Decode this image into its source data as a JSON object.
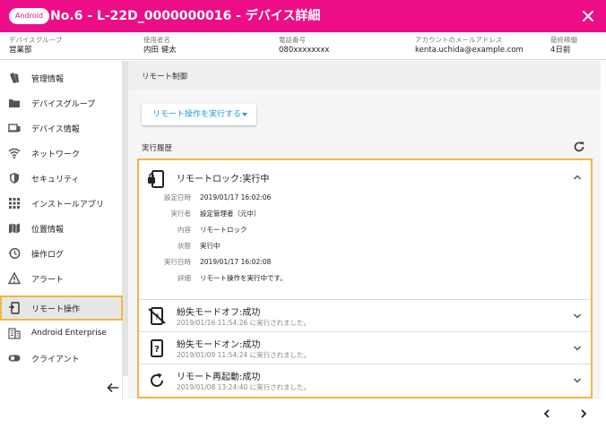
{
  "header": {
    "os_badge": "Android",
    "title": "No.6 - L-22D_0000000016 - デバイス詳細",
    "bg_color": "#ed0d87"
  },
  "info": {
    "group_label": "デバイスグループ",
    "group_value": "営業部",
    "user_label": "使用者名",
    "user_value": "内田 健太",
    "phone_label": "電話番号",
    "phone_value": "080xxxxxxxx",
    "email_label": "アカウントのメールアドレス",
    "email_value": "kenta.uchida@example.com",
    "last_label": "最終稼働",
    "last_value": "4日前"
  },
  "sidebar": {
    "items": [
      {
        "label": "管理情報",
        "icon": "book-icon"
      },
      {
        "label": "デバイスグループ",
        "icon": "folder-icon"
      },
      {
        "label": "デバイス情報",
        "icon": "devices-icon"
      },
      {
        "label": "ネットワーク",
        "icon": "wifi-icon"
      },
      {
        "label": "セキュリティ",
        "icon": "shield-icon"
      },
      {
        "label": "インストールアプリ",
        "icon": "apps-grid-icon"
      },
      {
        "label": "位置情報",
        "icon": "map-icon"
      },
      {
        "label": "操作ログ",
        "icon": "history-icon"
      },
      {
        "label": "アラート",
        "icon": "warning-icon"
      },
      {
        "label": "リモート操作",
        "icon": "phone-remote-icon",
        "active": true
      },
      {
        "label": "Android Enterprise",
        "icon": "business-icon"
      },
      {
        "label": "クライアント",
        "icon": "toggle-icon"
      }
    ]
  },
  "main": {
    "section_title": "リモート制御",
    "remote_button": "リモート操作を実行する",
    "history_label": "実行履歴",
    "expanded": {
      "title": "リモートロック:実行中",
      "details": [
        {
          "label": "設定日時",
          "value": "2019/01/17 16:02:06"
        },
        {
          "label": "実行者",
          "value": "設定管理者（元中）"
        },
        {
          "label": "内容",
          "value": "リモートロック"
        },
        {
          "label": "状態",
          "value": "実行中"
        },
        {
          "label": "実行日時",
          "value": "2019/01/17 16:02:08"
        },
        {
          "label": "詳細",
          "value": "リモート操作を実行中です。"
        }
      ]
    },
    "rows": [
      {
        "title": "紛失モードオフ:成功",
        "sub": "2019/01/16 11:54:26 に実行されました。",
        "icon": "lost-mode-off-icon"
      },
      {
        "title": "紛失モードオン:成功",
        "sub": "2019/01/09 11:54:24 に実行されました。",
        "icon": "lost-mode-on-icon"
      },
      {
        "title": "リモート再起動:成功",
        "sub": "2019/01/08 13:24:40 に実行されました。",
        "icon": "restart-icon"
      }
    ]
  },
  "colors": {
    "accent": "#ed0d87",
    "link": "#1e9cd8",
    "highlight": "#f1b844"
  }
}
